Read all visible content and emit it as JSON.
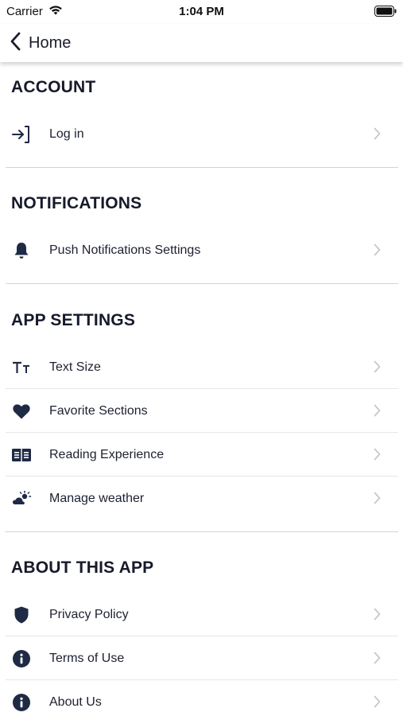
{
  "status": {
    "carrier": "Carrier",
    "time": "1:04 PM"
  },
  "nav": {
    "back_label": "Home"
  },
  "sections": {
    "account": {
      "title": "ACCOUNT",
      "items": [
        {
          "label": "Log in",
          "icon": "login-icon"
        }
      ]
    },
    "notifications": {
      "title": "NOTIFICATIONS",
      "items": [
        {
          "label": "Push Notifications Settings",
          "icon": "bell-icon"
        }
      ]
    },
    "app_settings": {
      "title": "APP SETTINGS",
      "items": [
        {
          "label": "Text Size",
          "icon": "text-size-icon"
        },
        {
          "label": "Favorite Sections",
          "icon": "heart-icon"
        },
        {
          "label": "Reading Experience",
          "icon": "book-icon"
        },
        {
          "label": "Manage weather",
          "icon": "weather-icon"
        }
      ]
    },
    "about": {
      "title": "ABOUT THIS APP",
      "items": [
        {
          "label": "Privacy Policy",
          "icon": "shield-icon"
        },
        {
          "label": "Terms of Use",
          "icon": "info-icon"
        },
        {
          "label": "About Us",
          "icon": "info-icon"
        }
      ]
    }
  },
  "colors": {
    "icon": "#1f2a44",
    "chevron": "#c8c8cc",
    "separator": "#d4d4d4"
  }
}
